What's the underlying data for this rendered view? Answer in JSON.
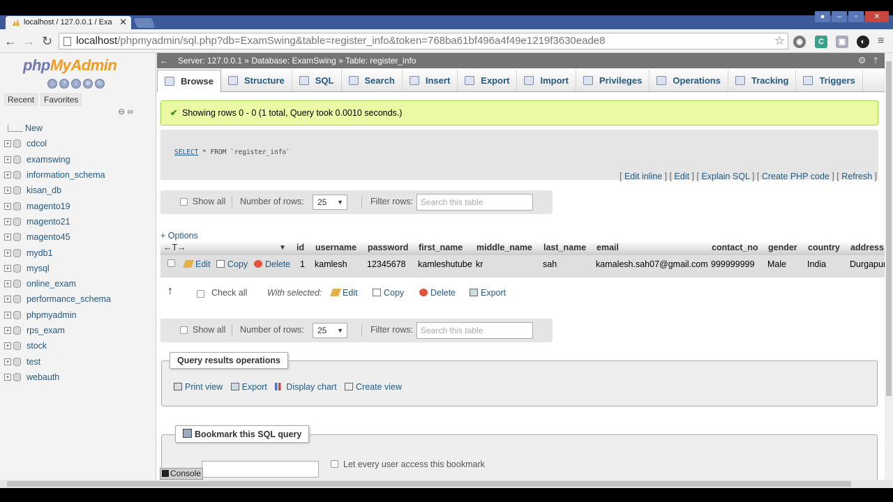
{
  "browser": {
    "tab_title": "localhost / 127.0.0.1 / Exa",
    "tab_close": "✕",
    "url_host": "localhost",
    "url_path": "/phpmyadmin/sql.php?db=ExamSwing&table=register_info&token=768ba61bf496a4f49e1219f3630eade8"
  },
  "sidebar": {
    "logo_php": "php",
    "logo_myadmin": "MyAdmin",
    "tabs": [
      "Recent",
      "Favorites"
    ],
    "new_label": "New",
    "databases": [
      "cdcol",
      "examswing",
      "information_schema",
      "kisan_db",
      "magento19",
      "magento21",
      "magento45",
      "mydb1",
      "mysql",
      "online_exam",
      "performance_schema",
      "phpmyadmin",
      "rps_exam",
      "stock",
      "test",
      "webauth"
    ]
  },
  "breadcrumb": {
    "server": "Server: 127.0.0.1",
    "database": "Database: ExamSwing",
    "table": "Table: register_info",
    "sep": "»"
  },
  "menu": [
    "Browse",
    "Structure",
    "SQL",
    "Search",
    "Insert",
    "Export",
    "Import",
    "Privileges",
    "Operations",
    "Tracking",
    "Triggers"
  ],
  "success_message": "Showing rows 0 - 0 (1 total, Query took 0.0010 seconds.)",
  "sql": {
    "keyword": "SELECT",
    "rest": " * FROM `register_info`",
    "links": [
      "Edit inline",
      "Edit",
      "Explain SQL",
      "Create PHP code",
      "Refresh"
    ]
  },
  "nav": {
    "show_all": "Show all",
    "number_of_rows": "Number of rows:",
    "rows_value": "25",
    "filter_rows": "Filter rows:",
    "filter_placeholder": "Search this table"
  },
  "options_link": "+ Options",
  "table": {
    "sort_arrows": "←T→",
    "columns": [
      "id",
      "username",
      "password",
      "first_name",
      "middle_name",
      "last_name",
      "email",
      "contact_no",
      "gender",
      "country",
      "address"
    ],
    "row_actions": [
      "Edit",
      "Copy",
      "Delete"
    ],
    "rows": [
      [
        "1",
        "kamlesh",
        "12345678",
        "kamleshutube",
        "kr",
        "sah",
        "kamalesh.sah07@gmail.com",
        "999999999",
        "Male",
        "India",
        "Durgapur"
      ]
    ]
  },
  "with_selected": {
    "arrow": "↑",
    "check_all": "Check all",
    "label": "With selected:",
    "actions": [
      "Edit",
      "Copy",
      "Delete",
      "Export"
    ]
  },
  "query_ops": {
    "title": "Query results operations",
    "links": [
      "Print view",
      "Export",
      "Display chart",
      "Create view"
    ]
  },
  "bookmark": {
    "title": "Bookmark this SQL query",
    "let_every_user": "Let every user access this bookmark"
  },
  "console_label": "Console"
}
